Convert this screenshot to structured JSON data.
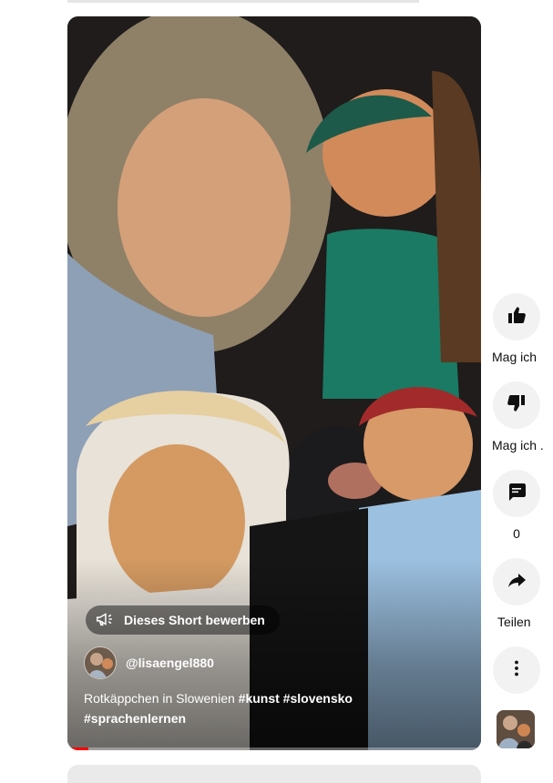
{
  "video": {
    "promote_label": "Dieses Short bewerben",
    "channel_handle": "@lisaengel880",
    "caption_text": "Rotkäppchen in Slowenien",
    "hashtags_line1": "#kunst #slovensko",
    "hashtags_line2": "#sprachenlernen",
    "progress": 0.05
  },
  "actions": {
    "like_label": "Mag ich",
    "dislike_label": "Mag ich .",
    "comments_count": "0",
    "share_label": "Teilen"
  },
  "colors": {
    "progress_accent": "#ff0000",
    "action_bg": "#f2f2f2"
  }
}
